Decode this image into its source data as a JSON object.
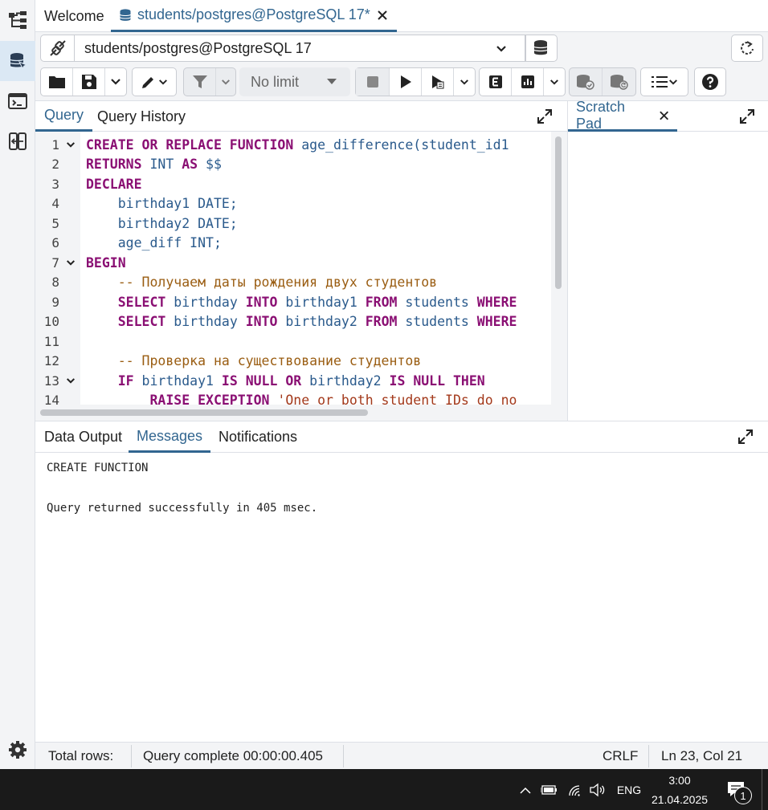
{
  "tabs": [
    {
      "label": "Welcome"
    },
    {
      "label": "students/postgres@PostgreSQL 17*"
    }
  ],
  "connection": {
    "label": "students/postgres@PostgreSQL 17"
  },
  "toolbar": {
    "limit_label": "No limit"
  },
  "editor_tabs": {
    "query": "Query",
    "history": "Query History",
    "scratch": "Scratch Pad"
  },
  "code_lines": [
    {
      "n": "1",
      "fold": true,
      "parts": [
        [
          "kw",
          "CREATE OR REPLACE FUNCTION "
        ],
        [
          "id",
          "age_difference(student_id1"
        ]
      ]
    },
    {
      "n": "2",
      "fold": false,
      "parts": [
        [
          "kw",
          "RETURNS "
        ],
        [
          "id",
          "INT "
        ],
        [
          "kw",
          "AS "
        ],
        [
          "id",
          "$$"
        ]
      ]
    },
    {
      "n": "3",
      "fold": false,
      "parts": [
        [
          "kw",
          "DECLARE"
        ]
      ]
    },
    {
      "n": "4",
      "fold": false,
      "parts": [
        [
          "id",
          "    birthday1 DATE;"
        ]
      ]
    },
    {
      "n": "5",
      "fold": false,
      "parts": [
        [
          "id",
          "    birthday2 DATE;"
        ]
      ]
    },
    {
      "n": "6",
      "fold": false,
      "parts": [
        [
          "id",
          "    age_diff INT;"
        ]
      ]
    },
    {
      "n": "7",
      "fold": true,
      "parts": [
        [
          "kw",
          "BEGIN"
        ]
      ]
    },
    {
      "n": "8",
      "fold": false,
      "parts": [
        [
          "cm",
          "    -- Получаем даты рождения двух студентов"
        ]
      ]
    },
    {
      "n": "9",
      "fold": false,
      "parts": [
        [
          "kw",
          "    SELECT "
        ],
        [
          "id",
          "birthday "
        ],
        [
          "kw",
          "INTO "
        ],
        [
          "id",
          "birthday1 "
        ],
        [
          "kw",
          "FROM "
        ],
        [
          "id",
          "students "
        ],
        [
          "kw",
          "WHERE"
        ]
      ]
    },
    {
      "n": "10",
      "fold": false,
      "parts": [
        [
          "kw",
          "    SELECT "
        ],
        [
          "id",
          "birthday "
        ],
        [
          "kw",
          "INTO "
        ],
        [
          "id",
          "birthday2 "
        ],
        [
          "kw",
          "FROM "
        ],
        [
          "id",
          "students "
        ],
        [
          "kw",
          "WHERE"
        ]
      ]
    },
    {
      "n": "11",
      "fold": false,
      "parts": []
    },
    {
      "n": "12",
      "fold": false,
      "parts": [
        [
          "cm",
          "    -- Проверка на существование студентов"
        ]
      ]
    },
    {
      "n": "13",
      "fold": true,
      "parts": [
        [
          "kw",
          "    IF "
        ],
        [
          "id",
          "birthday1 "
        ],
        [
          "kw",
          "IS NULL OR "
        ],
        [
          "id",
          "birthday2 "
        ],
        [
          "kw",
          "IS NULL THEN"
        ]
      ]
    },
    {
      "n": "14",
      "fold": false,
      "parts": [
        [
          "kw",
          "        RAISE EXCEPTION "
        ],
        [
          "str",
          "'One or both student IDs do no"
        ]
      ]
    }
  ],
  "results": {
    "tabs": [
      "Data Output",
      "Messages",
      "Notifications"
    ],
    "active_tab": "Messages",
    "messages": [
      "CREATE FUNCTION",
      "",
      "Query returned successfully in 405 msec."
    ]
  },
  "status": {
    "total_rows": "Total rows:",
    "query_complete": "Query complete 00:00:00.405",
    "eol": "CRLF",
    "position": "Ln 23, Col 21"
  },
  "taskbar": {
    "lang": "ENG",
    "time": "3:00",
    "date": "21.04.2025",
    "notif_count": "1"
  }
}
